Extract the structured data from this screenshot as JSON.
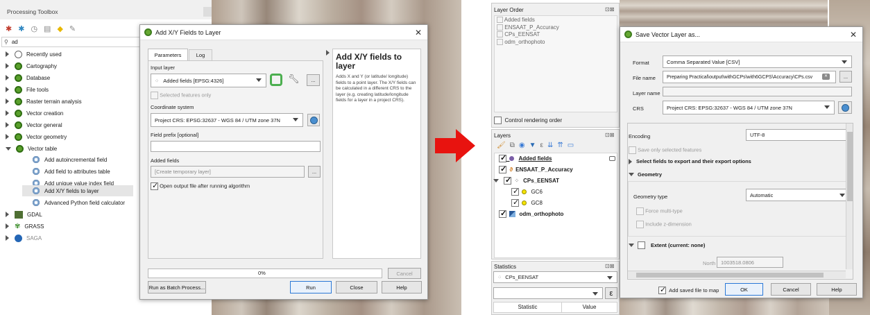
{
  "toolbox": {
    "title": "Processing Toolbox",
    "search_value": "ad",
    "groups": [
      {
        "label": "Recently used",
        "icon": "clock-icon"
      },
      {
        "label": "Cartography",
        "icon": "qgis-icon"
      },
      {
        "label": "Database",
        "icon": "qgis-icon"
      },
      {
        "label": "File tools",
        "icon": "qgis-icon"
      },
      {
        "label": "Raster terrain analysis",
        "icon": "qgis-icon"
      },
      {
        "label": "Vector creation",
        "icon": "qgis-icon"
      },
      {
        "label": "Vector general",
        "icon": "qgis-icon"
      },
      {
        "label": "Vector geometry",
        "icon": "qgis-icon"
      },
      {
        "label": "Vector table",
        "icon": "qgis-icon"
      }
    ],
    "vector_table_items": [
      "Add autoincremental field",
      "Add field to attributes table",
      "Add unique value index field",
      "Add X/Y fields to layer",
      "Advanced Python field calculator"
    ],
    "providers": [
      "GDAL",
      "GRASS",
      "SAGA"
    ]
  },
  "addxy": {
    "title": "Add X/Y Fields to Layer",
    "tabs": [
      "Parameters",
      "Log"
    ],
    "input_layer_label": "Input layer",
    "input_layer_value": "Added fields [EPSG:4326]",
    "selected_only_label": "Selected features only",
    "crs_label": "Coordinate system",
    "crs_value": "Project CRS: EPSG:32637 - WGS 84 / UTM zone 37N",
    "prefix_label": "Field prefix [optional]",
    "prefix_value": "",
    "added_fields_label": "Added fields",
    "added_fields_value": "[Create temporary layer]",
    "open_output_label": "Open output file after running algorithm",
    "help_title": "Add X/Y fields to layer",
    "help_text": "Adds X and Y (or latitude/ longitude) fields to a point layer. The X/Y fields can be calculated in a different CRS to the layer (e.g. creating latitude/longitude fields for a layer in a project CRS).",
    "progress": "0%",
    "progress_value": 0,
    "cancel": "Cancel",
    "batch": "Run as Batch Process...",
    "run": "Run",
    "close": "Close",
    "help": "Help",
    "ellipsis": "..."
  },
  "arrow_color": "#e8130f",
  "layer_order": {
    "title": "Layer Order",
    "items": [
      "Added fields",
      "ENSAAT_P_Accuracy",
      "CPs_EENSAT",
      "odm_orthophoto"
    ],
    "control_label": "Control rendering order"
  },
  "layers": {
    "title": "Layers",
    "rows": [
      {
        "label": "Added fields",
        "bold": true,
        "underline": true
      },
      {
        "label": "ENSAAT_P_Accuracy",
        "bold": true
      },
      {
        "label": "CPs_EENSAT",
        "bold": true
      },
      {
        "label": "GC6",
        "bold": false
      },
      {
        "label": "GC8",
        "bold": false
      },
      {
        "label": "odm_orthophoto",
        "bold": true
      }
    ]
  },
  "statistics": {
    "title": "Statistics",
    "layer": "CPs_EENSAT",
    "col_statistic": "Statistic",
    "col_value": "Value"
  },
  "save": {
    "title": "Save Vector Layer as...",
    "format_label": "Format",
    "format_value": "Comma Separated Value [CSV]",
    "filename_label": "File name",
    "filename_value": "Preparing Practical\\output\\withGCPs\\with6GCPS\\Accuracy\\CPs.csv",
    "layername_label": "Layer name",
    "crs_label": "CRS",
    "crs_value": "Project CRS: EPSG:32637 - WGS 84 / UTM zone 37N",
    "encoding_label": "Encoding",
    "encoding_value": "UTF-8",
    "save_selected_label": "Save only selected features",
    "select_fields_label": "Select fields to export and their export options",
    "geometry_label": "Geometry",
    "geometry_type_label": "Geometry type",
    "geometry_type_value": "Automatic",
    "force_multi_label": "Force multi-type",
    "include_z_label": "Include z-dimension",
    "extent_label": "Extent (current: none)",
    "north_label": "North",
    "north_value": "1003518.0806",
    "add_saved_label": "Add saved file to map",
    "ok": "OK",
    "cancel": "Cancel",
    "help": "Help",
    "ellipsis": "..."
  }
}
